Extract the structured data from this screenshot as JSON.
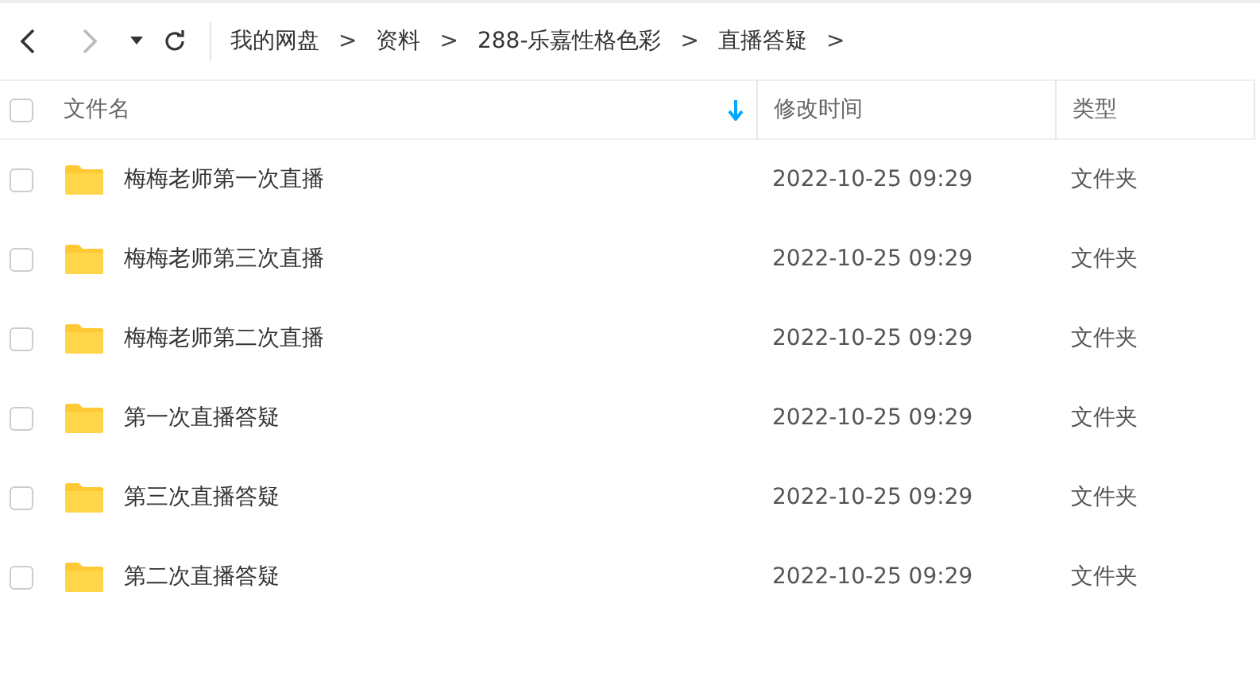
{
  "breadcrumbs": [
    {
      "label": "我的网盘",
      "separator": ">"
    },
    {
      "label": "资料",
      "separator": ">"
    },
    {
      "label": "288-乐嘉性格色彩",
      "separator": ">"
    },
    {
      "label": "直播答疑",
      "separator": ">"
    }
  ],
  "table": {
    "select_all_checked": false,
    "columns": [
      {
        "label": "文件名",
        "sorted": true
      },
      {
        "label": "修改时间",
        "sorted": false
      },
      {
        "label": "类型",
        "sorted": false
      }
    ],
    "rows": [
      {
        "checked": false,
        "name": "梅梅老师第一次直播",
        "modified": "2022-10-25 09:29",
        "type": "文件夹"
      },
      {
        "checked": false,
        "name": "梅梅老师第三次直播",
        "modified": "2022-10-25 09:29",
        "type": "文件夹"
      },
      {
        "checked": false,
        "name": "梅梅老师第二次直播",
        "modified": "2022-10-25 09:29",
        "type": "文件夹"
      },
      {
        "checked": false,
        "name": "第一次直播答疑",
        "modified": "2022-10-25 09:29",
        "type": "文件夹"
      },
      {
        "checked": false,
        "name": "第三次直播答疑",
        "modified": "2022-10-25 09:29",
        "type": "文件夹"
      },
      {
        "checked": false,
        "name": "第二次直播答疑",
        "modified": "2022-10-25 09:29",
        "type": "文件夹"
      }
    ]
  }
}
